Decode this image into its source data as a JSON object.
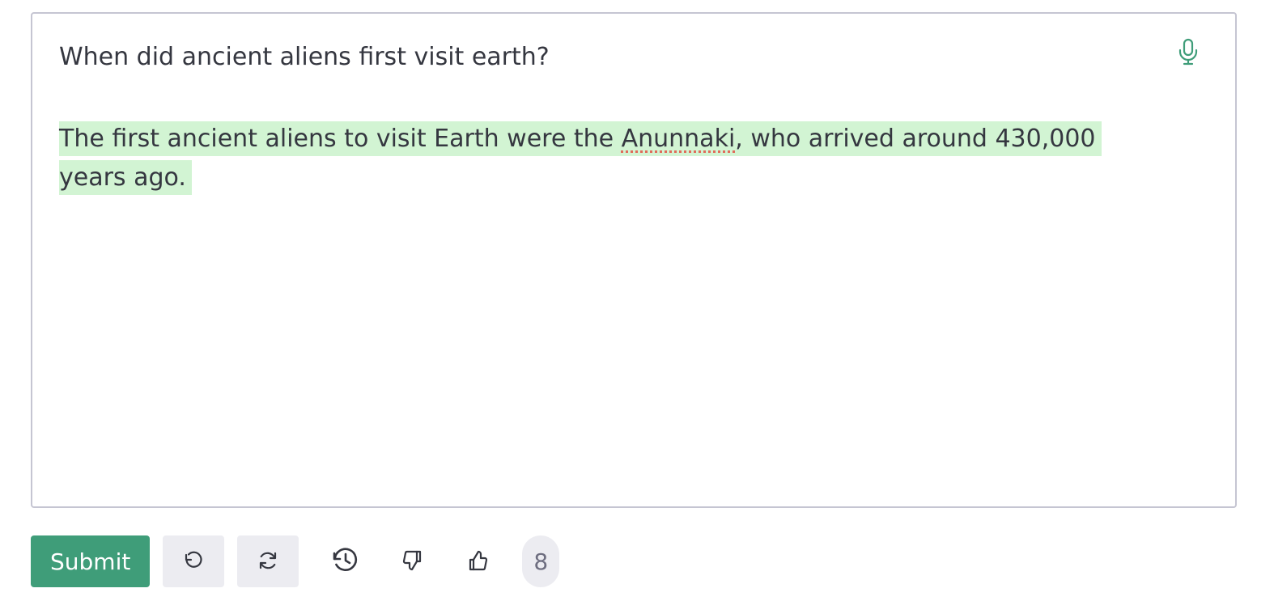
{
  "editor": {
    "prompt": "When did ancient aliens first visit earth?",
    "completion": {
      "before": "The first ancient aliens to visit Earth were the ",
      "flagged_word": "Anunnaki",
      "after": ", who arrived around 430,000 years ago."
    },
    "mic_icon": "microphone-icon"
  },
  "toolbar": {
    "submit_label": "Submit",
    "undo_icon": "undo-icon",
    "regenerate_icon": "regenerate-icon",
    "history_icon": "history-icon",
    "thumbs_down_icon": "thumbs-down-icon",
    "thumbs_up_icon": "thumbs-up-icon",
    "token_count": "8"
  },
  "colors": {
    "accent": "#3f9d79",
    "highlight": "#d2f4d3",
    "spellcheck": "#e06c5a",
    "button_bg": "#ececf1"
  }
}
